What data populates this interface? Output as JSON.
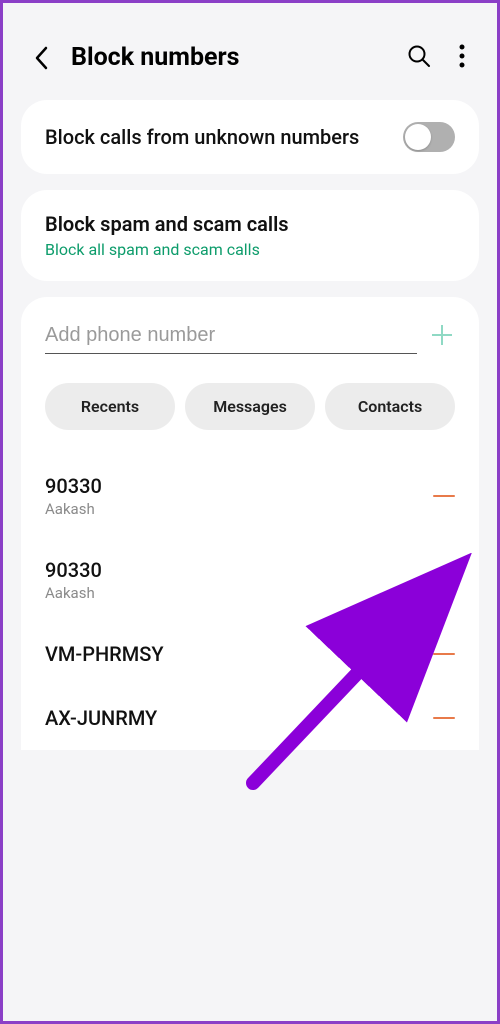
{
  "header": {
    "title": "Block numbers"
  },
  "settings": {
    "blockUnknown": {
      "label": "Block calls from unknown numbers",
      "enabled": false
    },
    "blockSpam": {
      "title": "Block spam and scam calls",
      "subtitle": "Block all spam and scam calls"
    }
  },
  "addPhone": {
    "placeholder": "Add phone number"
  },
  "tabs": [
    {
      "label": "Recents"
    },
    {
      "label": "Messages"
    },
    {
      "label": "Contacts"
    }
  ],
  "blockedList": [
    {
      "number": "90330",
      "name": "Aakash"
    },
    {
      "number": "90330",
      "name": "Aakash"
    },
    {
      "number": "VM-PHRMSY",
      "name": ""
    },
    {
      "number": "AX-JUNRMY",
      "name": ""
    }
  ]
}
